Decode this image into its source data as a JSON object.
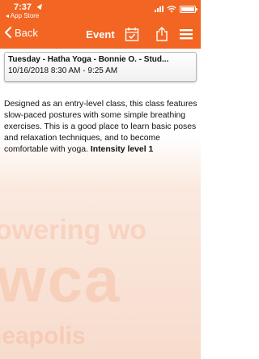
{
  "status_bar": {
    "time": "7:37",
    "back_to_app": "◂ App Store"
  },
  "nav": {
    "back_label": "Back",
    "title": "Event"
  },
  "event": {
    "title": "Tuesday - Hatha Yoga - Bonnie O. - Stud...",
    "time": "10/16/2018 8:30 AM - 9:25 AM",
    "description": "Designed as an entry-level class, this class features slow-paced postures with some simple breathing exercises. This is a good place to learn basic poses and relaxation techniques, and to become comfortable with yoga. ",
    "intensity": "Intensity level 1"
  },
  "background": {
    "line1": "owering wo",
    "line2": "wca",
    "line3": "neapolis"
  },
  "colors": {
    "brand_orange": "#f26522",
    "text": "#111111"
  },
  "icons": [
    "location-arrow-icon",
    "cellular-signal-icon",
    "wifi-icon",
    "battery-icon",
    "chevron-left-icon",
    "calendar-check-icon",
    "share-icon",
    "hamburger-menu-icon"
  ]
}
